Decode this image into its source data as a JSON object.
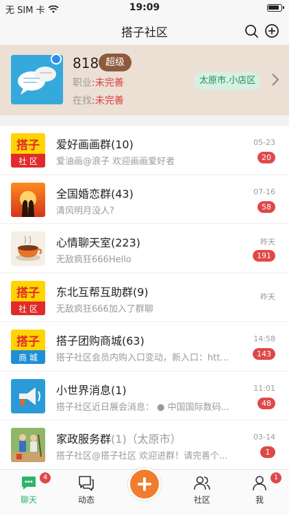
{
  "status": {
    "carrier": "无 SIM 卡",
    "time": "19:09"
  },
  "nav": {
    "title": "搭子社区"
  },
  "profile": {
    "name": "818",
    "level": "超级",
    "job_label": "职业",
    "job_value": ":未完善",
    "seek_label": "在找",
    "seek_value": ":未完善",
    "location": "太原市.小店区"
  },
  "chats": [
    {
      "name": "爱好画画群(10)",
      "extra": "",
      "message": "爱油画@浪子  欢迎画画爱好者",
      "time": "05-23",
      "badge": "20",
      "thumb_text": [
        "搭子",
        "社 区"
      ]
    },
    {
      "name": "全国婚恋群(43)",
      "extra": "",
      "message": "清风明月没人?",
      "time": "07-16",
      "badge": "58"
    },
    {
      "name": "心情聊天室(223)",
      "extra": "",
      "message": "无敌疯狂666Hello",
      "time": "昨天",
      "badge": "191"
    },
    {
      "name": "东北互帮互助群(9)",
      "extra": "",
      "message": "无敌疯狂666加入了群聊",
      "time": "昨天",
      "badge": "",
      "thumb_text": [
        "搭子",
        "社 区"
      ]
    },
    {
      "name": "搭子团购商城(63)",
      "extra": "",
      "message": "搭子社区会员内购入口变动，新入口：htt...",
      "time": "14:58",
      "badge": "143",
      "thumb_text": [
        "搭子",
        "商 城"
      ]
    },
    {
      "name": "小世界消息(1)",
      "extra": "",
      "message": "搭子社区近日展会消息：  ●  中国国际数码...",
      "time": "11:01",
      "badge": "48"
    },
    {
      "name": "家政服务群",
      "extra": "(1)（太原市）",
      "message": "搭子社区@搭子社区  欢迎进群！请完善个...",
      "time": "03-14",
      "badge": "1"
    }
  ],
  "tabs": [
    {
      "label": "聊天",
      "badge": "4",
      "icon": "chat-icon"
    },
    {
      "label": "动态",
      "badge": "",
      "icon": "moments-icon"
    },
    {
      "label": "社区",
      "badge": "",
      "icon": "community-icon"
    },
    {
      "label": "我",
      "badge": "1",
      "icon": "profile-icon"
    }
  ],
  "colors": {
    "accent": "#2fb36a",
    "badge": "#e04848",
    "fab": "#f07d2e",
    "profile_bg": "#ecdfd4"
  }
}
